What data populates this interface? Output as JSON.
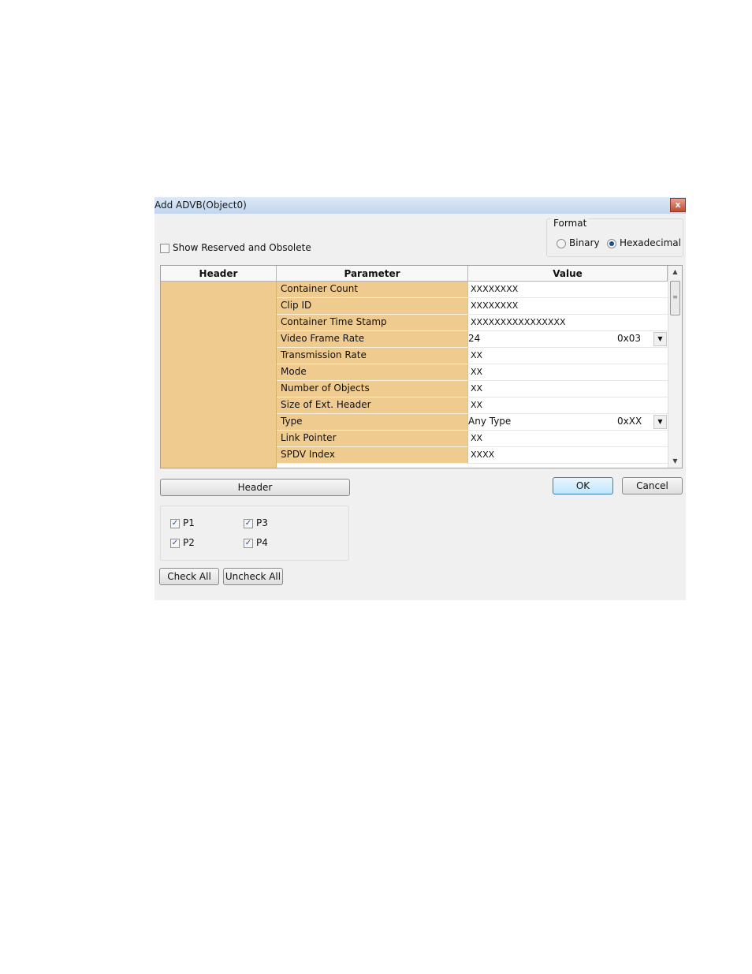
{
  "dialog": {
    "title": "Add ADVB(Object0)",
    "close_label": "x"
  },
  "options": {
    "show_reserved_label": "Show Reserved and Obsolete",
    "show_reserved_checked": false
  },
  "format": {
    "legend": "Format",
    "binary_label": "Binary",
    "hex_label": "Hexadecimal",
    "selected": "Hexadecimal"
  },
  "grid": {
    "columns": [
      "Header",
      "Parameter",
      "Value"
    ],
    "rows": [
      {
        "parameter": "Container Count",
        "value": "XXXXXXXX"
      },
      {
        "parameter": "Clip ID",
        "value": "XXXXXXXX"
      },
      {
        "parameter": "Container Time Stamp",
        "value": "XXXXXXXXXXXXXXXX"
      },
      {
        "parameter": "Video Frame Rate",
        "value": "24",
        "combo_hex": "0x03"
      },
      {
        "parameter": "Transmission Rate",
        "value": "XX"
      },
      {
        "parameter": "Mode",
        "value": "XX"
      },
      {
        "parameter": "Number of Objects",
        "value": "XX"
      },
      {
        "parameter": "Size of Ext. Header",
        "value": "XX"
      },
      {
        "parameter": "Type",
        "value": "Any Type",
        "combo_hex": "0xXX"
      },
      {
        "parameter": "Link Pointer",
        "value": "XX"
      },
      {
        "parameter": "SPDV Index",
        "value": "XXXX"
      }
    ]
  },
  "buttons": {
    "header": "Header",
    "ok": "OK",
    "cancel": "Cancel",
    "check_all": "Check All",
    "uncheck_all": "Uncheck All"
  },
  "packets": {
    "p1": "P1",
    "p2": "P2",
    "p3": "P3",
    "p4": "P4"
  }
}
